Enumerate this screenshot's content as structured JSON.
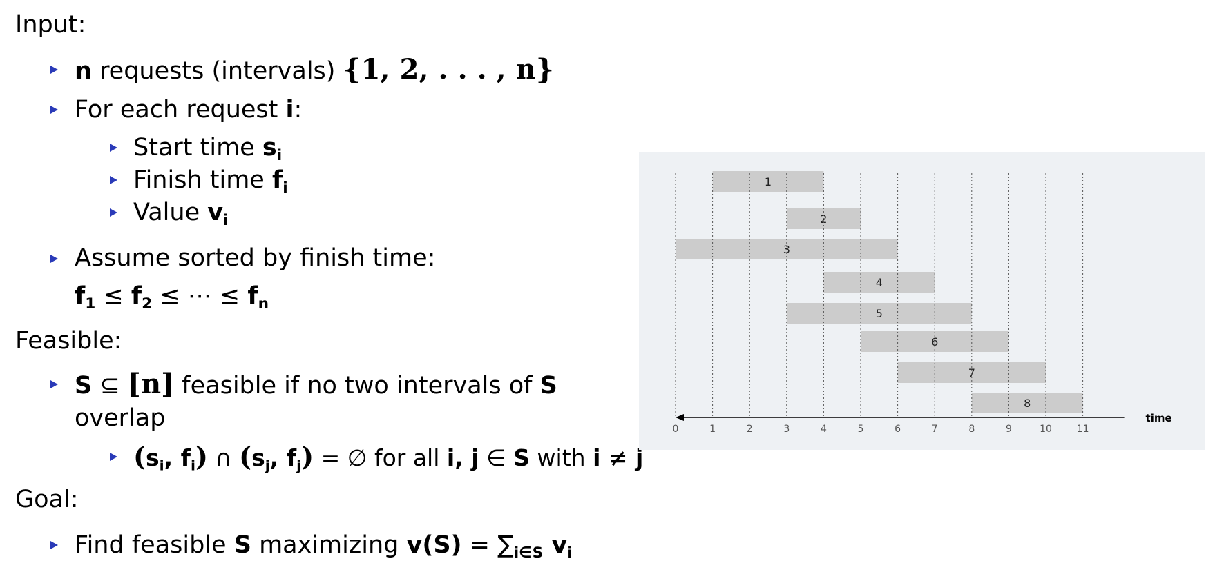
{
  "sections": {
    "input": "Input:",
    "feasible": "Feasible:",
    "goal": "Goal:"
  },
  "input_items": {
    "n_var": "n",
    "requests_text": "requests (intervals)",
    "request_set": "{1, 2, . . . , n}",
    "for_each": "For each request",
    "i_var": "i",
    "colon": ":",
    "start_time": "Start time",
    "s_var": "s",
    "finish_time": "Finish time",
    "f_var": "f",
    "value": "Value",
    "v_var": "v",
    "sub_i": "i",
    "assume_sorted": "Assume sorted by finish time:"
  },
  "sorted_formula": {
    "f1": "f",
    "sub1": "1",
    "leq1": " ≤ ",
    "f2": "f",
    "sub2": "2",
    "leq_dots": " ≤ ⋯ ≤ ",
    "fn": "f",
    "subn": "n"
  },
  "feasible_items": {
    "S_var": "S",
    "subseteq": " ⊆ ",
    "n_bracket": "[n]",
    "feasible_text": "feasible if no two intervals of",
    "S_var2": "S",
    "overlap": "overlap",
    "open1": "(",
    "s_i": "s",
    "sub_i1": "i",
    "comma1": ", ",
    "f_i": "f",
    "sub_i2": "i",
    "close1": ")",
    "cap": " ∩ ",
    "open2": "(",
    "s_j": "s",
    "sub_j1": "j",
    "comma2": ", ",
    "f_j": "f",
    "sub_j2": "j",
    "close2": ")",
    "eq_empty": " = ∅ for all ",
    "ij": "i, j",
    "in_S": " ∈ ",
    "S_var3": "S",
    "with": " with ",
    "i_neq_j": "i ≠ j"
  },
  "goal_items": {
    "find_text": "Find feasible",
    "S_var": "S",
    "maximizing": "maximizing",
    "vS": "v(S)",
    "eq_sum": " = ∑",
    "sum_sub": "i∈S",
    "v_var": " v",
    "v_sub": "i"
  },
  "chart_data": {
    "type": "gantt",
    "xlabel": "time",
    "ticks": [
      0,
      1,
      2,
      3,
      4,
      5,
      6,
      7,
      8,
      9,
      10,
      11
    ],
    "intervals": [
      {
        "label": "1",
        "start": 1,
        "end": 4
      },
      {
        "label": "2",
        "start": 3,
        "end": 5
      },
      {
        "label": "3",
        "start": 0,
        "end": 6
      },
      {
        "label": "4",
        "start": 4,
        "end": 7
      },
      {
        "label": "5",
        "start": 3,
        "end": 8
      },
      {
        "label": "6",
        "start": 5,
        "end": 9
      },
      {
        "label": "7",
        "start": 6,
        "end": 10
      },
      {
        "label": "8",
        "start": 8,
        "end": 11
      }
    ],
    "colors": {
      "bar": "#cccccc",
      "background": "#eef1f4",
      "grid": "#555555",
      "axis": "#000000",
      "tick_text": "#555555"
    }
  }
}
